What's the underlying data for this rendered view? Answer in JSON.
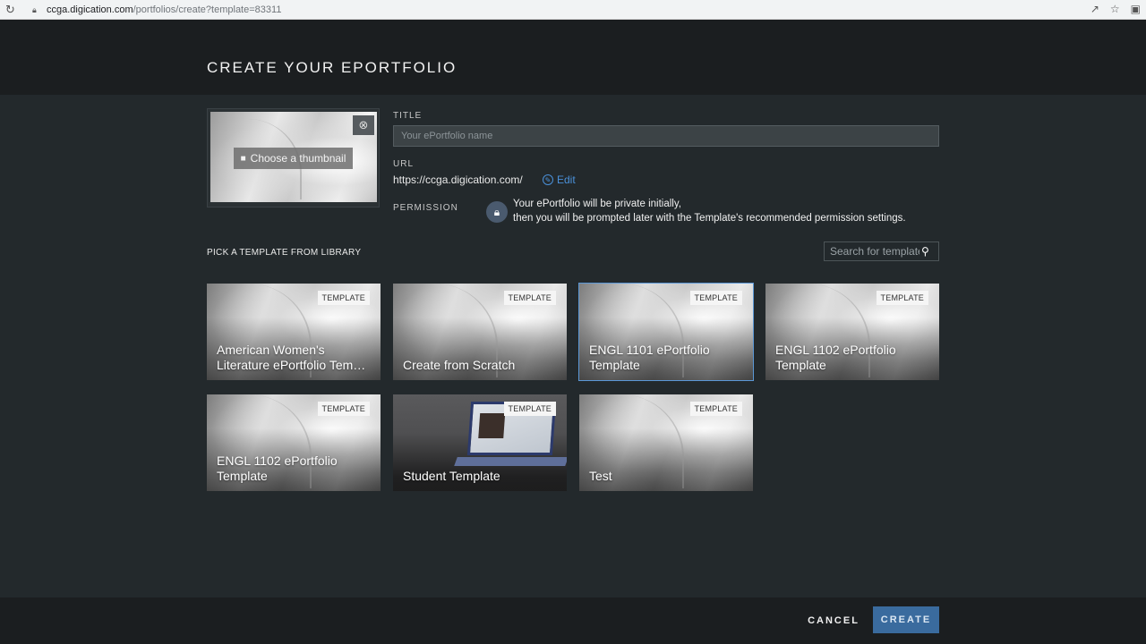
{
  "browser": {
    "url_host": "ccga.digication.com",
    "url_path": "/portfolios/create?template=83311"
  },
  "page": {
    "title": "CREATE YOUR EPORTFOLIO"
  },
  "thumbnail": {
    "choose_label": "Choose a thumbnail"
  },
  "form": {
    "title_label": "TITLE",
    "title_placeholder": "Your ePortfolio name",
    "title_value": "",
    "url_label": "URL",
    "url_value": "https://ccga.digication.com/",
    "edit_label": "Edit",
    "permission_label": "PERMISSION",
    "permission_line1": "Your ePortfolio will be private initially,",
    "permission_line2": "then you will be prompted later with the Template's recommended permission settings."
  },
  "library": {
    "heading": "PICK A TEMPLATE FROM LIBRARY",
    "search_placeholder": "Search for template",
    "badge_label": "TEMPLATE",
    "templates": [
      {
        "title": "American Women's Literature ePortfolio Tem…",
        "selected": false
      },
      {
        "title": "Create from Scratch",
        "selected": false
      },
      {
        "title": "ENGL 1101 ePortfolio Template",
        "selected": true
      },
      {
        "title": "ENGL 1102 ePortfolio Template",
        "selected": false
      },
      {
        "title": "ENGL 1102 ePortfolio Template",
        "selected": false
      },
      {
        "title": "Student Template",
        "selected": false
      },
      {
        "title": "Test",
        "selected": false
      }
    ]
  },
  "footer": {
    "cancel_label": "CANCEL",
    "create_label": "CREATE"
  },
  "colors": {
    "accent": "#3a6b9e",
    "link": "#4a90d9",
    "selected_outline": "#5b97d6"
  }
}
